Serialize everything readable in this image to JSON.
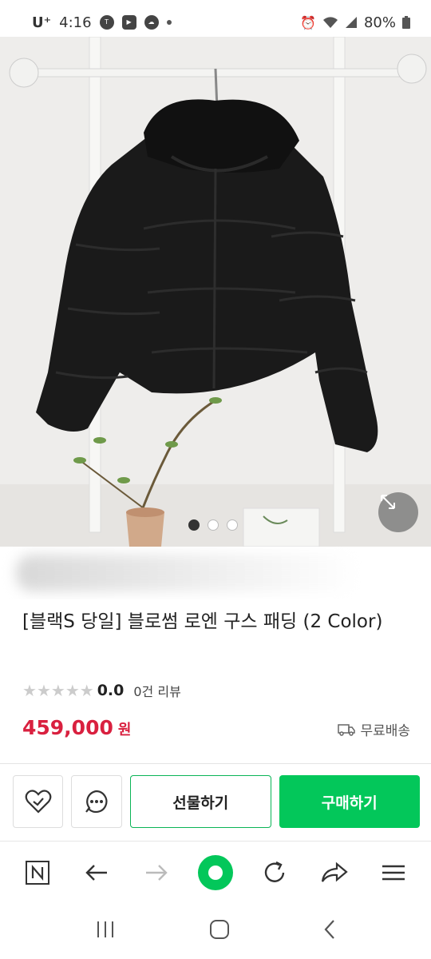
{
  "status_bar": {
    "carrier": "U⁺",
    "time": "4:16",
    "battery": "80%"
  },
  "carousel": {
    "dots": [
      true,
      false,
      false
    ]
  },
  "product": {
    "title": "[블랙S 당일] 블로썸 로엔 구스 패딩 (2 Color)",
    "rating": "0.0",
    "review_count": "0건 리뷰",
    "price": "459,000",
    "price_unit": "원",
    "shipping": "무료배송"
  },
  "actions": {
    "gift_label": "선물하기",
    "buy_label": "구매하기"
  },
  "colors": {
    "brand_green": "#03c75a",
    "price_red": "#d9203f"
  },
  "icons": {
    "wishlist": "heart-check-icon",
    "chat": "chat-bubble-icon",
    "naver": "naver-n-icon",
    "back": "arrow-left-icon",
    "forward": "arrow-right-icon",
    "home": "green-circle-icon",
    "reload": "reload-icon",
    "share": "share-icon",
    "menu": "menu-icon"
  }
}
